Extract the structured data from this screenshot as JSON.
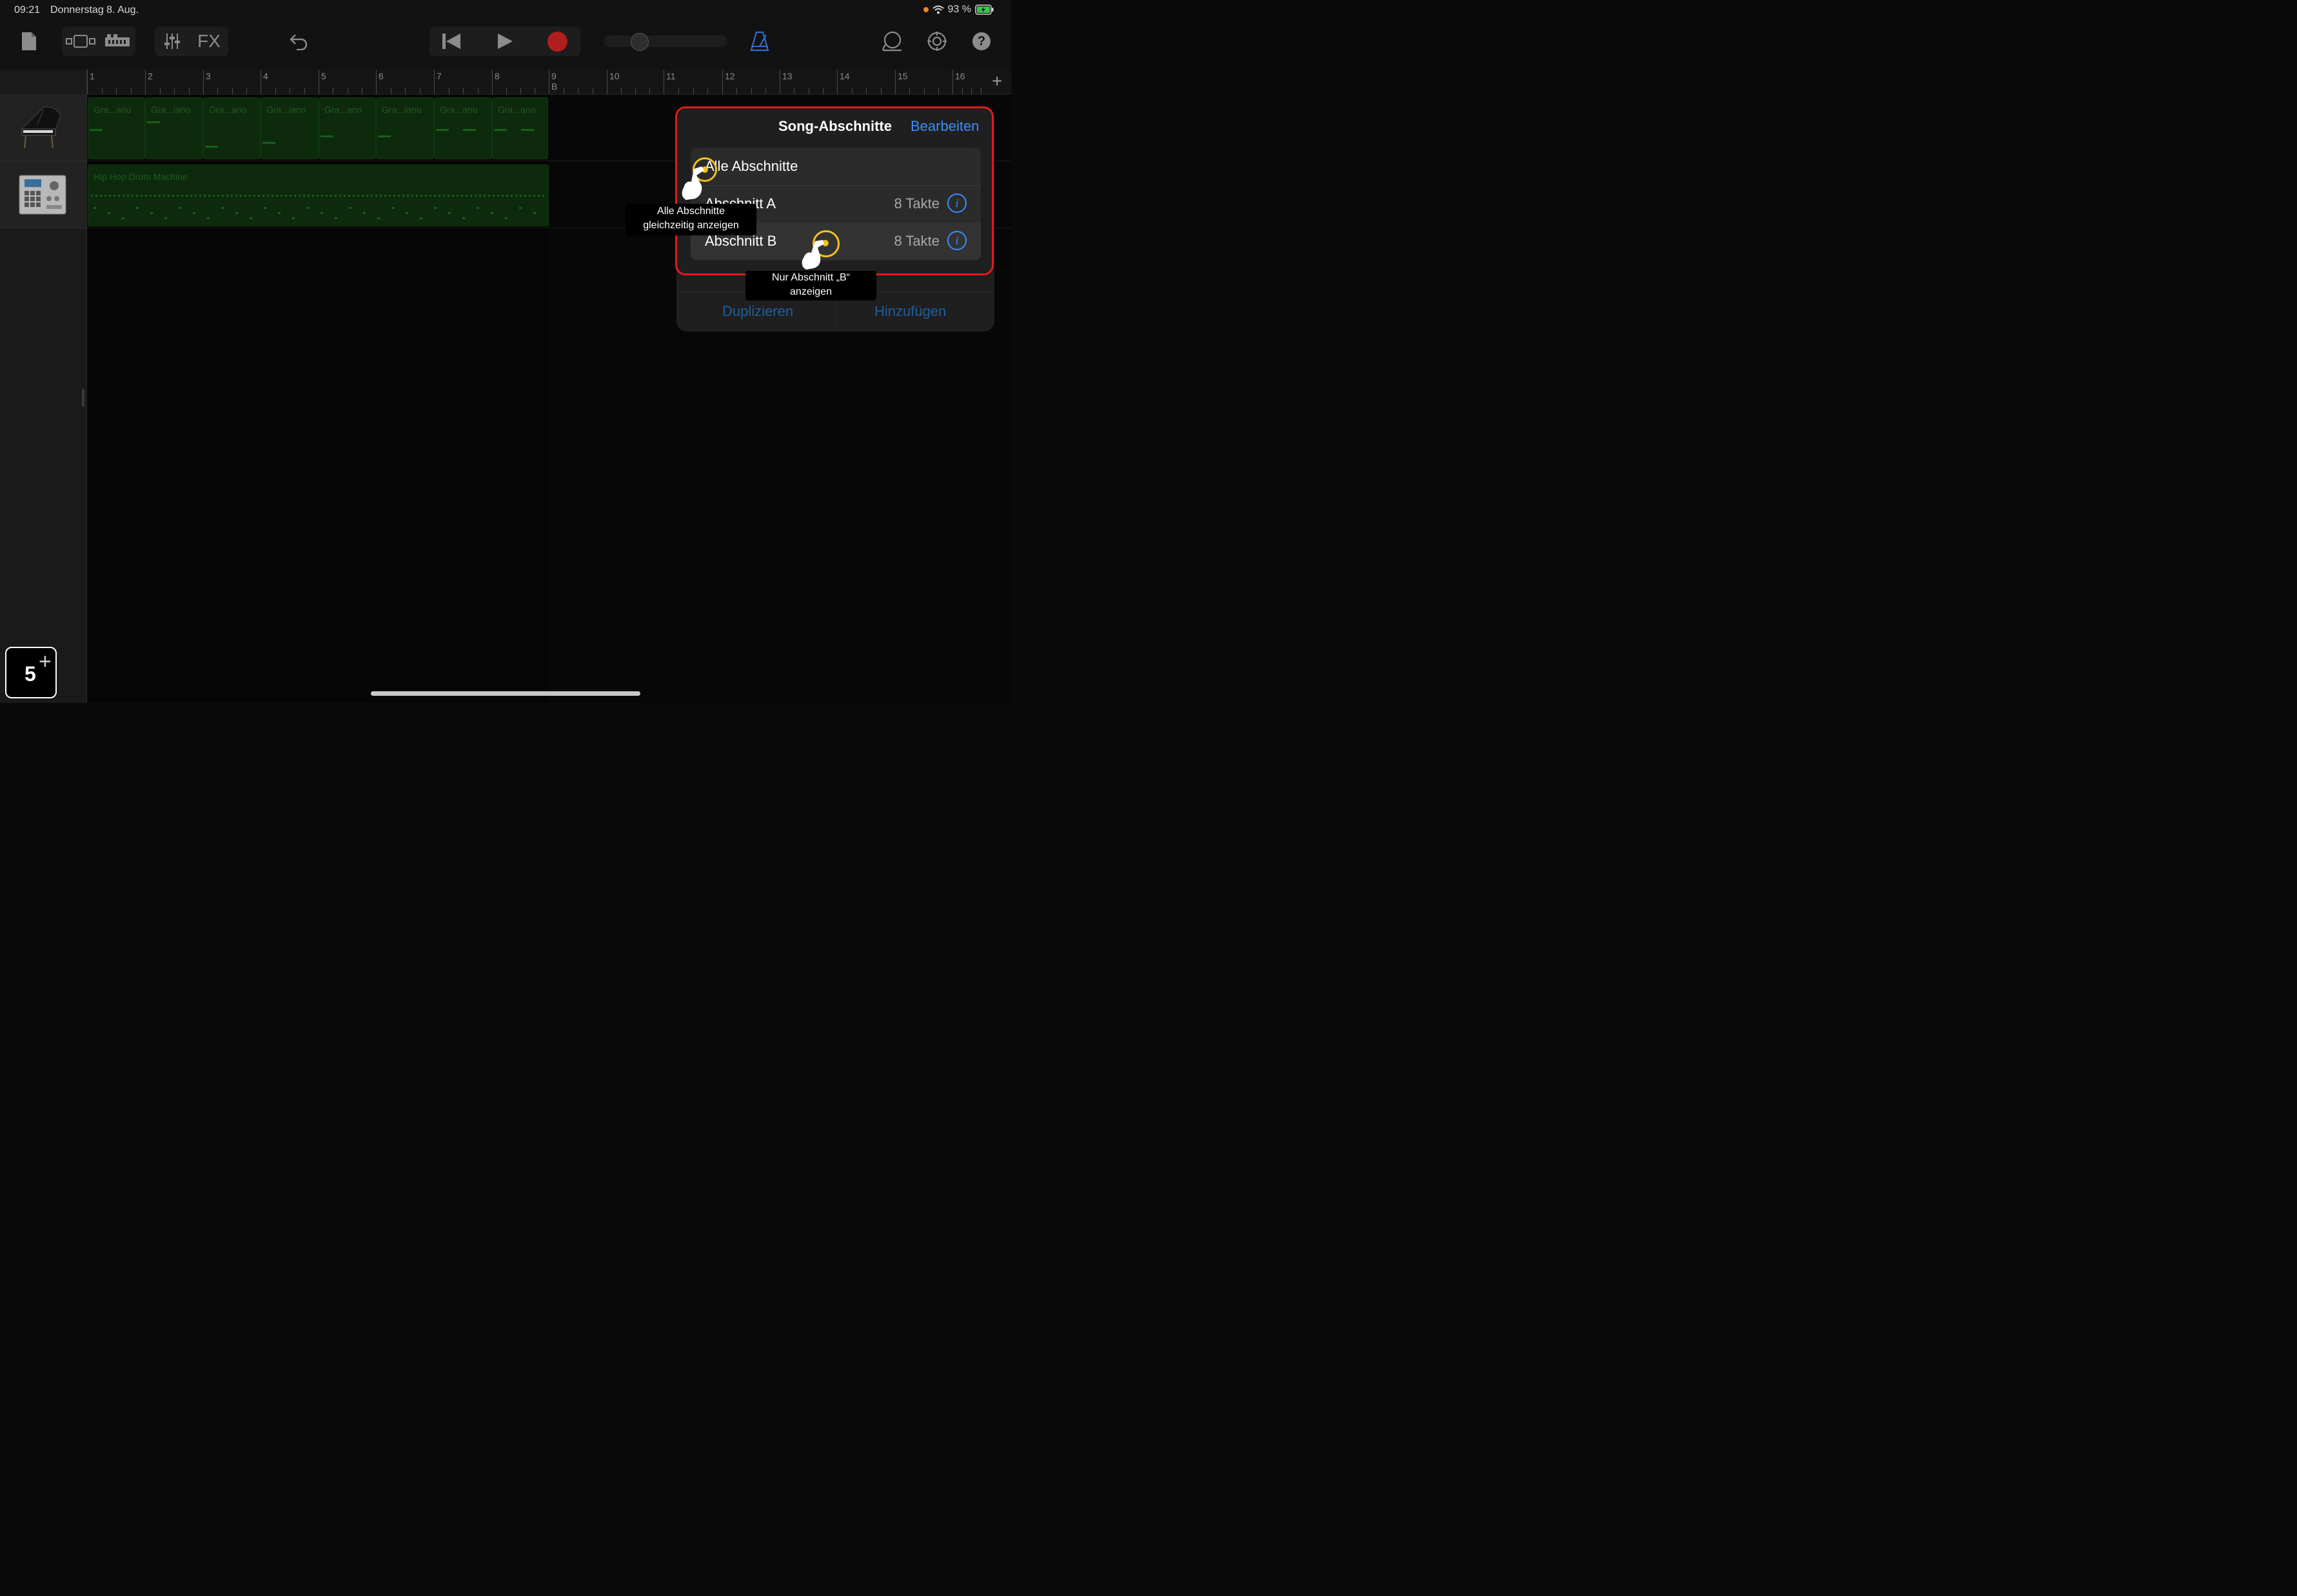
{
  "status": {
    "time": "09:21",
    "date": "Donnerstag 8. Aug.",
    "battery": "93 %"
  },
  "toolbar": {
    "fx_label": "FX"
  },
  "ruler": {
    "bars": [
      "1",
      "2",
      "3",
      "4",
      "5",
      "6",
      "7",
      "8",
      "9",
      "10",
      "11",
      "12",
      "13",
      "14",
      "15",
      "16"
    ],
    "section_marker": "B",
    "add_label": "+"
  },
  "tracks": [
    {
      "name": "Grand Piano",
      "icon": "piano-icon"
    },
    {
      "name": "Hip Hop Drum Machine",
      "icon": "drum-machine-icon"
    }
  ],
  "regions": {
    "piano": [
      "Gra...ano",
      "Gra...iano",
      "Gra...ano",
      "Gra...iano",
      "Gra...ano",
      "Gra...iano",
      "Gra...ano",
      "Gra...ano"
    ],
    "drum": "Hip Hop Drum Machine"
  },
  "popover": {
    "title": "Song-Abschnitte",
    "edit": "Bearbeiten",
    "rows": [
      {
        "label": "Alle Abschnitte",
        "takte": ""
      },
      {
        "label": "Abschnitt A",
        "takte": "8 Takte"
      },
      {
        "label": "Abschnitt B",
        "takte": "8 Takte"
      }
    ],
    "duplicate": "Duplizieren",
    "add": "Hinzufügen"
  },
  "callouts": {
    "all": "Alle Abschnitte gleichzeitig anzeigen",
    "all_line1": "Alle Abschnitte",
    "all_line2": "gleichzeitig anzeigen",
    "b_line1": "Nur Abschnitt „B“",
    "b_line2": "anzeigen"
  },
  "step": {
    "number": "5"
  },
  "colors": {
    "accent": "#3c8cff",
    "highlight": "#e01c1c",
    "tap": "#f2c21b",
    "region": "#0d2a0d"
  }
}
